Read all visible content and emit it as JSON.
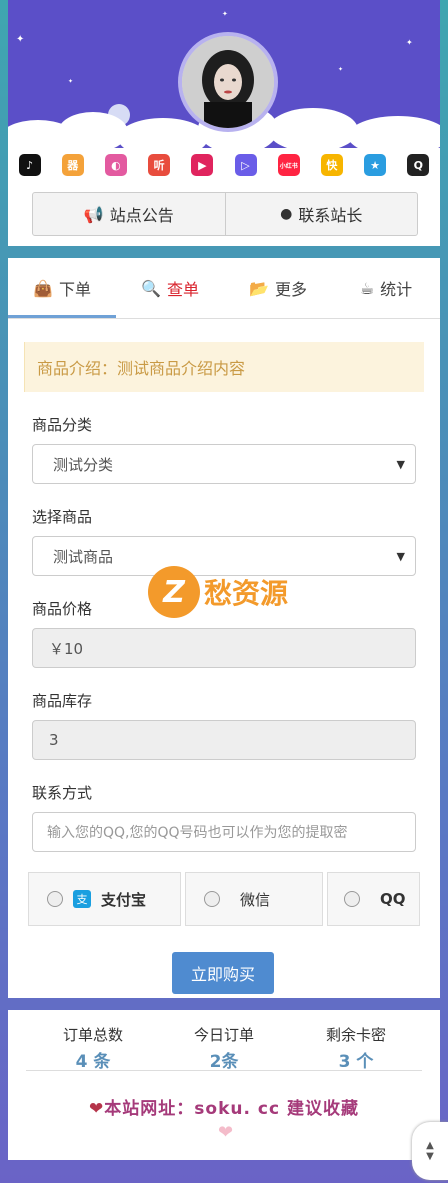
{
  "header": {
    "announce_label": "站点公告",
    "contact_label": "联系站长",
    "apps": [
      {
        "name": "douyin-icon",
        "glyph": "♪",
        "color": "#111"
      },
      {
        "name": "app2-icon",
        "glyph": "器",
        "color": "#f4a23a"
      },
      {
        "name": "app3-icon",
        "glyph": "◐",
        "color": "#e35aa0"
      },
      {
        "name": "ting-icon",
        "glyph": "听",
        "color": "#e84c3d"
      },
      {
        "name": "video-icon",
        "glyph": "▶",
        "color": "#e0245e"
      },
      {
        "name": "bilibili-icon",
        "glyph": "▷",
        "color": "#6a5de8"
      },
      {
        "name": "xiaohongshu-icon",
        "glyph": "小红书",
        "color": "#ff2442"
      },
      {
        "name": "app8-icon",
        "glyph": "快",
        "color": "#f7b500"
      },
      {
        "name": "star-icon",
        "glyph": "★",
        "color": "#2a9de0"
      },
      {
        "name": "qq-icon",
        "glyph": "Q",
        "color": "#222"
      }
    ]
  },
  "tabs": [
    {
      "label": "下单",
      "icon": "shopping-bag-icon"
    },
    {
      "label": "查单",
      "icon": "search-icon"
    },
    {
      "label": "更多",
      "icon": "folder-open-icon"
    },
    {
      "label": "统计",
      "icon": "coffee-icon"
    }
  ],
  "form": {
    "notice": "商品介绍：测试商品介绍内容",
    "category_label": "商品分类",
    "category_value": "测试分类",
    "product_label": "选择商品",
    "product_value": "测试商品",
    "price_label": "商品价格",
    "price_value": "￥10",
    "stock_label": "商品库存",
    "stock_value": "3",
    "contact_label": "联系方式",
    "contact_placeholder": "输入您的QQ,您的QQ号码也可以作为您的提取密",
    "pay_options": [
      "支付宝",
      "微信",
      "QQ"
    ],
    "buy_label": "立即购买"
  },
  "watermark": {
    "glyph": "Z",
    "text": "愁资源"
  },
  "stats": [
    {
      "title": "订单总数",
      "value": "4 条"
    },
    {
      "title": "今日订单",
      "value": "2条"
    },
    {
      "title": "剩余卡密",
      "value": "3 个"
    }
  ],
  "footer": {
    "site_text": "本站网址：soku. cc 建议收藏"
  }
}
